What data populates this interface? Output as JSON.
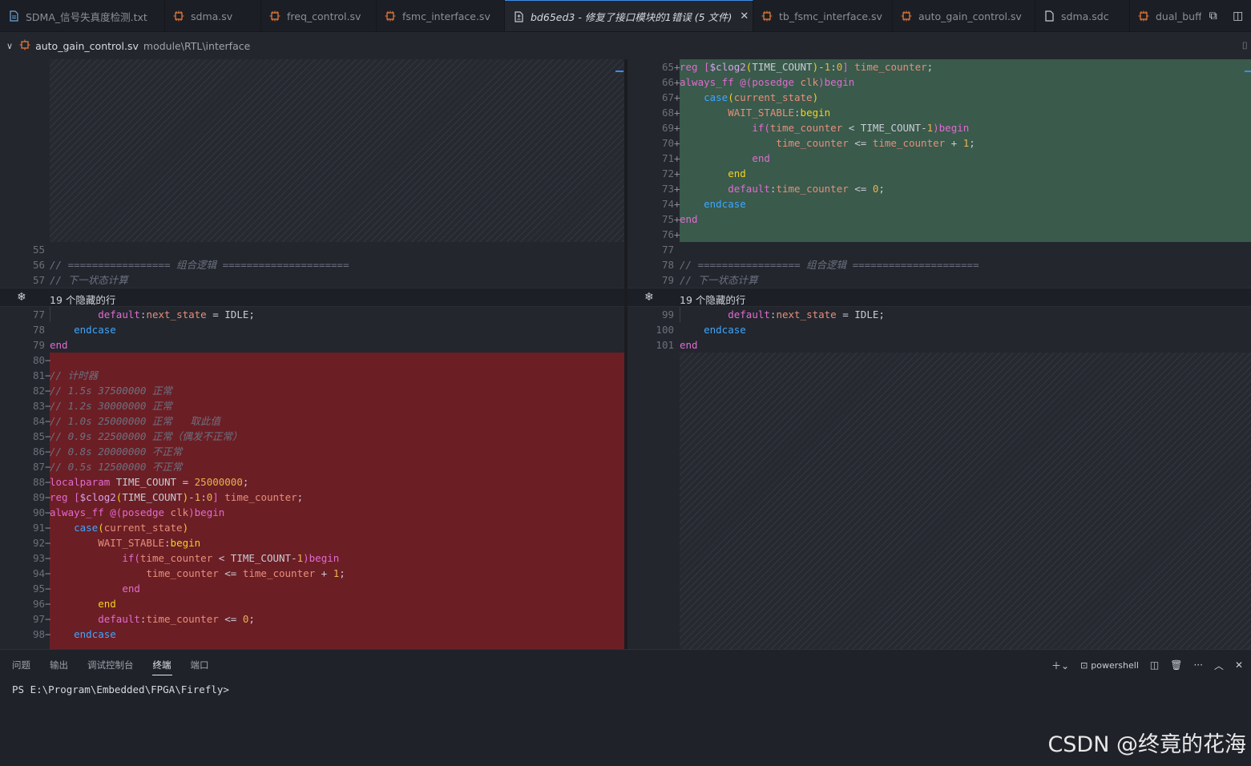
{
  "tabs": [
    {
      "label": "SDMA_信号失真度检测.txt",
      "icon": "text-file-icon"
    },
    {
      "label": "sdma.sv",
      "icon": "verilog-file-icon"
    },
    {
      "label": "freq_control.sv",
      "icon": "verilog-file-icon"
    },
    {
      "label": "fsmc_interface.sv",
      "icon": "verilog-file-icon"
    },
    {
      "label": "bd65ed3 - 修复了接口模块的1错误 (5 文件)",
      "icon": "diff-icon",
      "active": true
    },
    {
      "label": "tb_fsmc_interface.sv",
      "icon": "verilog-file-icon"
    },
    {
      "label": "auto_gain_control.sv",
      "icon": "verilog-file-icon"
    },
    {
      "label": "sdma.sdc",
      "icon": "file-icon"
    },
    {
      "label": "dual_buff",
      "icon": "verilog-file-icon"
    }
  ],
  "breadcrumb": {
    "file": "auto_gain_control.sv",
    "path": "module\\RTL\\interface"
  },
  "fold": {
    "left": "19 个隐藏的行",
    "right": "19 个隐藏的行"
  },
  "left_lines": [
    {
      "n": "55",
      "m": "",
      "text": ""
    },
    {
      "n": "56",
      "m": "",
      "text": "// ================= 组合逻辑 ====================="
    },
    {
      "n": "57",
      "m": "",
      "text": "// 下一状态计算"
    },
    {
      "n": "77",
      "m": "",
      "text": "        default:next_state = IDLE;"
    },
    {
      "n": "78",
      "m": "",
      "text": "    endcase"
    },
    {
      "n": "79",
      "m": "",
      "text": "end"
    },
    {
      "n": "80",
      "m": "−",
      "text": ""
    },
    {
      "n": "81",
      "m": "−",
      "text": "// 计时器"
    },
    {
      "n": "82",
      "m": "−",
      "text": "// 1.5s 37500000 正常"
    },
    {
      "n": "83",
      "m": "−",
      "text": "// 1.2s 30000000 正常"
    },
    {
      "n": "84",
      "m": "−",
      "text": "// 1.0s 25000000 正常   取此值"
    },
    {
      "n": "85",
      "m": "−",
      "text": "// 0.9s 22500000 正常（偶发不正常）"
    },
    {
      "n": "86",
      "m": "−",
      "text": "// 0.8s 20000000 不正常"
    },
    {
      "n": "87",
      "m": "−",
      "text": "// 0.5s 12500000 不正常"
    },
    {
      "n": "88",
      "m": "−",
      "text": "localparam TIME_COUNT = 25000000;"
    },
    {
      "n": "89",
      "m": "−",
      "text": "reg [$clog2(TIME_COUNT)-1:0] time_counter;"
    },
    {
      "n": "90",
      "m": "−",
      "text": "always_ff @(posedge clk)begin"
    },
    {
      "n": "91",
      "m": "−",
      "text": "    case(current_state)"
    },
    {
      "n": "92",
      "m": "−",
      "text": "        WAIT_STABLE:begin"
    },
    {
      "n": "93",
      "m": "−",
      "text": "            if(time_counter < TIME_COUNT-1)begin"
    },
    {
      "n": "94",
      "m": "−",
      "text": "                time_counter <= time_counter + 1;"
    },
    {
      "n": "95",
      "m": "−",
      "text": "            end"
    },
    {
      "n": "96",
      "m": "−",
      "text": "        end"
    },
    {
      "n": "97",
      "m": "−",
      "text": "        default:time_counter <= 0;"
    },
    {
      "n": "98",
      "m": "−",
      "text": "    endcase"
    }
  ],
  "right_lines": [
    {
      "n": "65",
      "m": "+",
      "text": "reg [$clog2(TIME_COUNT)-1:0] time_counter;"
    },
    {
      "n": "66",
      "m": "+",
      "text": "always_ff @(posedge clk)begin"
    },
    {
      "n": "67",
      "m": "+",
      "text": "    case(current_state)"
    },
    {
      "n": "68",
      "m": "+",
      "text": "        WAIT_STABLE:begin"
    },
    {
      "n": "69",
      "m": "+",
      "text": "            if(time_counter < TIME_COUNT-1)begin"
    },
    {
      "n": "70",
      "m": "+",
      "text": "                time_counter <= time_counter + 1;"
    },
    {
      "n": "71",
      "m": "+",
      "text": "            end"
    },
    {
      "n": "72",
      "m": "+",
      "text": "        end"
    },
    {
      "n": "73",
      "m": "+",
      "text": "        default:time_counter <= 0;"
    },
    {
      "n": "74",
      "m": "+",
      "text": "    endcase"
    },
    {
      "n": "75",
      "m": "+",
      "text": "end"
    },
    {
      "n": "76",
      "m": "+",
      "text": ""
    },
    {
      "n": "77",
      "m": "",
      "text": ""
    },
    {
      "n": "78",
      "m": "",
      "text": "// ================= 组合逻辑 ====================="
    },
    {
      "n": "79",
      "m": "",
      "text": "// 下一状态计算"
    },
    {
      "n": "99",
      "m": "",
      "text": "        default:next_state = IDLE;"
    },
    {
      "n": "100",
      "m": "",
      "text": "    endcase"
    },
    {
      "n": "101",
      "m": "",
      "text": "end"
    }
  ],
  "panel": {
    "tabs": [
      "问题",
      "输出",
      "调试控制台",
      "终端",
      "端口"
    ],
    "active_tab": "终端",
    "shell": "powershell",
    "prompt": "PS E:\\Program\\Embedded\\FPGA\\Firefly>"
  },
  "watermark": "CSDN @终竟的花海",
  "colors": {
    "deleted": "#6c1e25",
    "added": "#3a5a4c",
    "accent": "#3b8eea"
  }
}
